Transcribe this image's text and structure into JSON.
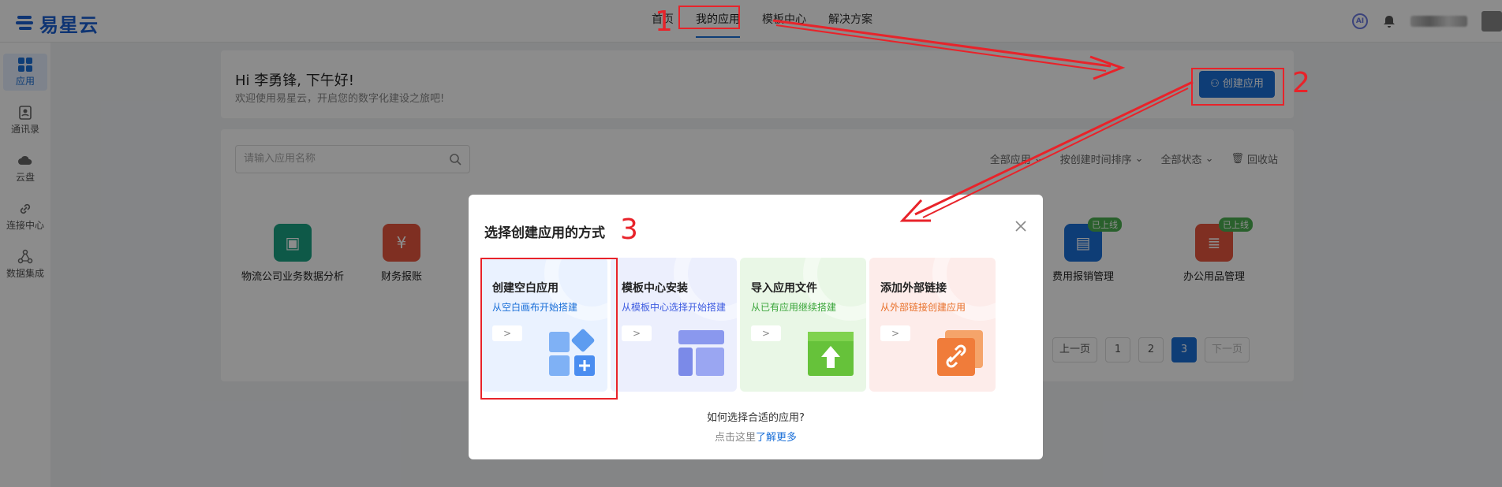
{
  "brand": {
    "name": "易星云",
    "color": "#1a5fd1"
  },
  "topnav": {
    "items": [
      {
        "label": "首页",
        "active": false
      },
      {
        "label": "我的应用",
        "active": true
      },
      {
        "label": "模板中心",
        "active": false
      },
      {
        "label": "解决方案",
        "active": false
      }
    ]
  },
  "topright": {
    "ai_label": "AI"
  },
  "sidebar": {
    "items": [
      {
        "label": "应用",
        "icon": "apps-icon",
        "active": true
      },
      {
        "label": "通讯录",
        "icon": "contacts-icon"
      },
      {
        "label": "云盘",
        "icon": "cloud-icon"
      },
      {
        "label": "连接中心",
        "icon": "link-icon"
      },
      {
        "label": "数据集成",
        "icon": "data-integration-icon"
      }
    ]
  },
  "greeting": {
    "title": "Hi 李勇锋, 下午好!",
    "subtitle": "欢迎使用易星云，开启您的数字化建设之旅吧!"
  },
  "create_button": {
    "label": "创建应用"
  },
  "search": {
    "placeholder": "请输入应用名称"
  },
  "filters": {
    "all_apps": "全部应用",
    "sort": "按创建时间排序",
    "status": "全部状态",
    "recycle": "回收站"
  },
  "apps": [
    {
      "name": "物流公司业务数据分析",
      "color": "#1aa384",
      "icon": "bus-icon"
    },
    {
      "name": "财务报账",
      "color": "#e8563f",
      "icon": "yuan-icon"
    },
    {
      "name": "费用报销管理",
      "color": "#1a6fd8",
      "icon": "receipt-icon",
      "badge": "已上线"
    },
    {
      "name": "办公用品管理",
      "color": "#e8563f",
      "icon": "document-icon",
      "badge": "已上线"
    }
  ],
  "pagination": {
    "prev": "上一页",
    "pages": [
      "1",
      "2",
      "3"
    ],
    "current": "3",
    "next": "下一页"
  },
  "modal": {
    "title": "选择创建应用的方式",
    "cards": [
      {
        "title": "创建空白应用",
        "subtitle": "从空白画布开始搭建",
        "accent": "#1a6fd8",
        "bg": "#eaf2ff",
        "icon": "blank-app-icon"
      },
      {
        "title": "模板中心安装",
        "subtitle": "从模板中心选择开始搭建",
        "accent": "#3d5be0",
        "bg": "#eceffd",
        "icon": "template-icon"
      },
      {
        "title": "导入应用文件",
        "subtitle": "从已有应用继续搭建",
        "accent": "#3aa53a",
        "bg": "#e9f7e6",
        "icon": "import-icon"
      },
      {
        "title": "添加外部链接",
        "subtitle": "从外部链接创建应用",
        "accent": "#e8702a",
        "bg": "#fdecea",
        "icon": "external-link-icon"
      }
    ],
    "go_glyph": ">",
    "help_question": "如何选择合适的应用?",
    "help_prefix": "点击这里",
    "help_link": "了解更多"
  },
  "annotations": {
    "labels": [
      "1",
      "2",
      "3"
    ],
    "color": "#e8232a"
  }
}
